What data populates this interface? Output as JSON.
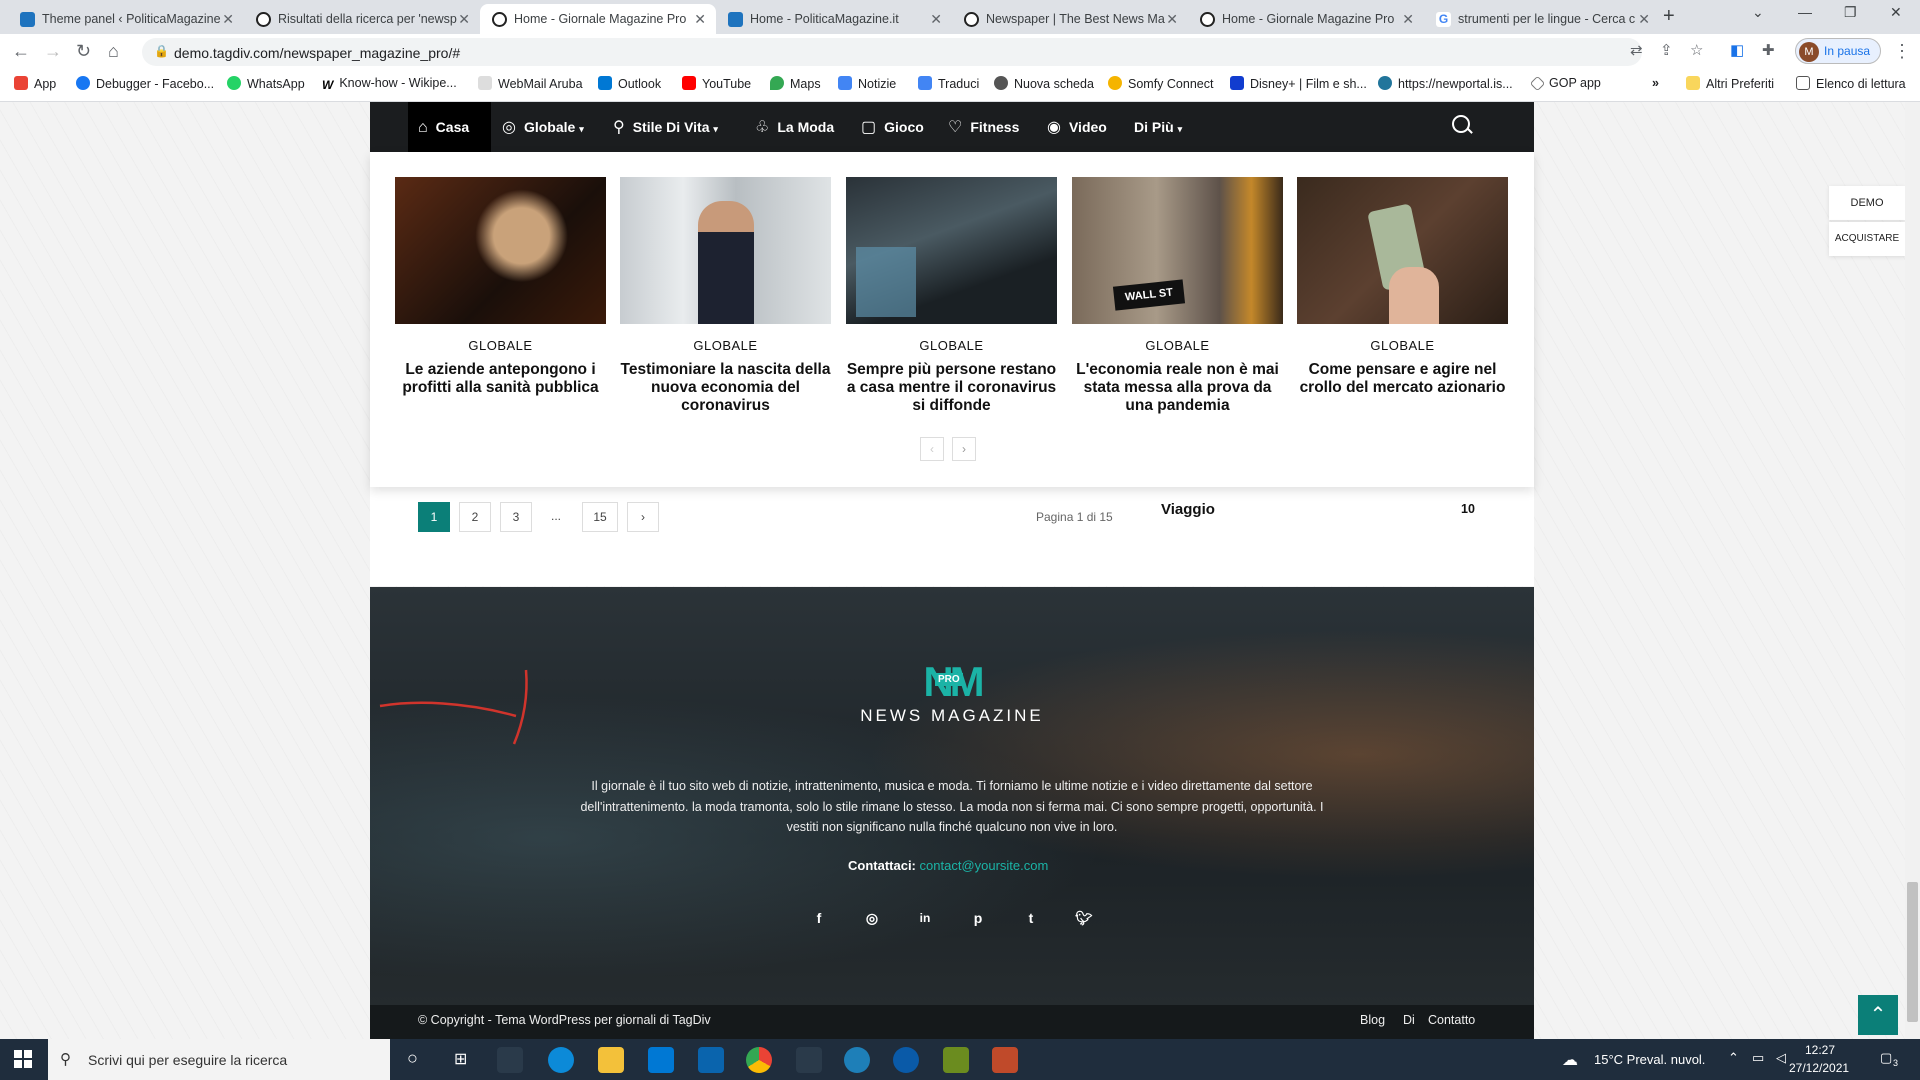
{
  "browser": {
    "tabs": [
      {
        "title": "Theme panel ‹ PoliticaMagazine"
      },
      {
        "title": "Risultati della ricerca per 'newsp"
      },
      {
        "title": "Home - Giornale Magazine Pro"
      },
      {
        "title": "Home - PoliticaMagazine.it"
      },
      {
        "title": "Newspaper | The Best News Ma"
      },
      {
        "title": "Home - Giornale Magazine Pro"
      },
      {
        "title": "strumenti per le lingue - Cerca c"
      }
    ],
    "url": "demo.tagdiv.com/newspaper_magazine_pro/#",
    "profile_status": "In pausa",
    "profile_initial": "M",
    "bookmarks": [
      "App",
      "Debugger - Facebo...",
      "WhatsApp",
      "Know-how - Wikipe...",
      "WebMail Aruba",
      "Outlook",
      "YouTube",
      "Maps",
      "Notizie",
      "Traduci",
      "Nuova scheda",
      "Somfy Connect",
      "Disney+ | Film e sh...",
      "https://newportal.is...",
      "GOP app"
    ],
    "bookmarks_overflow": "»",
    "other_bookmarks": "Altri Preferiti",
    "reading_list": "Elenco di lettura"
  },
  "site": {
    "nav": [
      {
        "label": "Casa",
        "icon": "home-icon"
      },
      {
        "label": "Globale",
        "icon": "globe-icon"
      },
      {
        "label": "Stile Di Vita",
        "icon": "bike-icon"
      },
      {
        "label": "La Moda",
        "icon": "dress-icon"
      },
      {
        "label": "Gioco",
        "icon": "game-icon"
      },
      {
        "label": "Fitness",
        "icon": "heart-icon"
      },
      {
        "label": "Video",
        "icon": "play-icon"
      },
      {
        "label": "Di Più",
        "icon": ""
      }
    ],
    "articles": [
      {
        "category": "GLOBALE",
        "title": "Le aziende antepongono i profitti alla sanità pubblica"
      },
      {
        "category": "GLOBALE",
        "title": "Testimoniare la nascita della nuova economia del coronavirus"
      },
      {
        "category": "GLOBALE",
        "title": "Sempre più persone restano a casa mentre il coronavirus si diffonde"
      },
      {
        "category": "GLOBALE",
        "title": "L'economia reale non è mai stata messa alla prova da una pandemia"
      },
      {
        "category": "GLOBALE",
        "title": "Come pensare e agire nel crollo del mercato azionario"
      }
    ],
    "slider_prev": "‹",
    "slider_next": "›",
    "pagination": {
      "pages": [
        "1",
        "2",
        "3",
        "...",
        "15"
      ],
      "next": "›",
      "info": "Pagina 1 di 15"
    },
    "sidebar_category": {
      "label": "Viaggio",
      "count": "10"
    },
    "side_buttons": {
      "demo": "DEMO",
      "buy": "ACQUISTARE"
    },
    "footer": {
      "logo_mark": "NM",
      "logo_badge": "PRO",
      "logo_text": "NEWS MAGAZINE",
      "about": "Il giornale è il tuo sito web di notizie, intrattenimento, musica e moda. Ti forniamo le ultime notizie e i video direttamente dal settore dell'intrattenimento. la moda tramonta, solo lo stile rimane lo stesso. La moda non si ferma mai. Ci sono sempre progetti, opportunità. I vestiti non significano nulla finché qualcuno non vive in loro.",
      "contact_label": "Contattaci:",
      "contact_email": "contact@yoursite.com",
      "social": [
        "facebook-icon",
        "instagram-icon",
        "linkedin-icon",
        "pinterest-icon",
        "tumblr-icon",
        "twitter-icon"
      ],
      "copyright": "© Copyright - Tema WordPress per giornali di TagDiv",
      "links": [
        "Blog",
        "Di",
        "Contatto"
      ]
    }
  },
  "taskbar": {
    "search_placeholder": "Scrivi qui per eseguire la ricerca",
    "weather": "15°C  Preval. nuvol.",
    "time": "12:27",
    "date": "27/12/2021",
    "notifications": "3"
  },
  "colors": {
    "accent": "#0b7f78",
    "logo": "#1bb3a6",
    "nav_bg": "#1b1d1f"
  }
}
